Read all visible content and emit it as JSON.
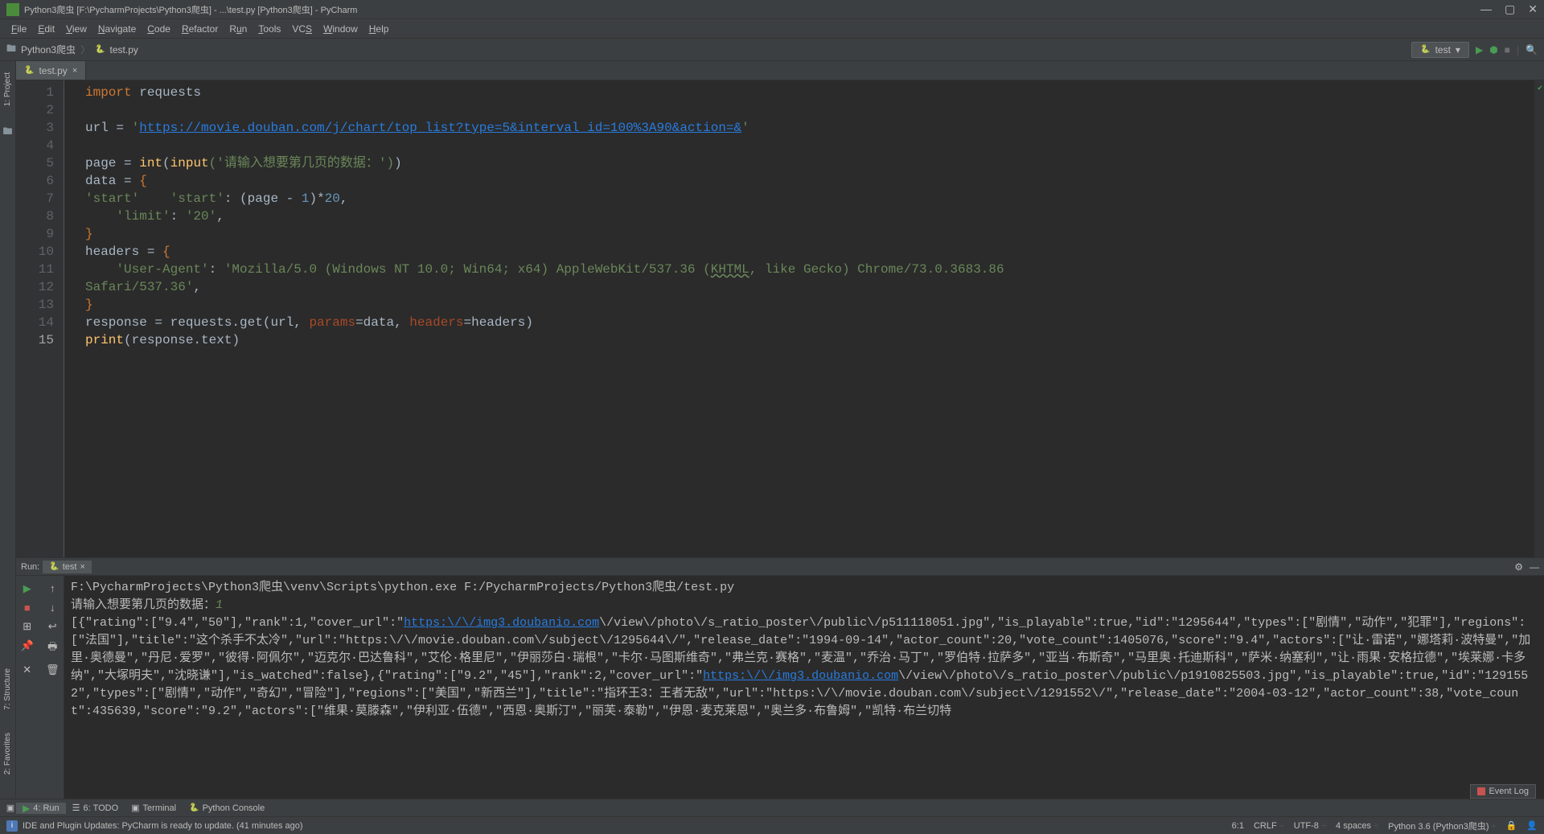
{
  "window": {
    "title": "Python3爬虫 [F:\\PycharmProjects\\Python3爬虫] - ...\\test.py [Python3爬虫] - PyCharm"
  },
  "menu": {
    "file": "File",
    "edit": "Edit",
    "view": "View",
    "navigate": "Navigate",
    "code": "Code",
    "refactor": "Refactor",
    "run": "Run",
    "tools": "Tools",
    "vcs": "VCS",
    "window": "Window",
    "help": "Help"
  },
  "breadcrumb": {
    "project": "Python3爬虫",
    "file": "test.py"
  },
  "run_config": {
    "name": "test"
  },
  "tab": {
    "file": "test.py"
  },
  "code": {
    "lines": [
      "1",
      "2",
      "3",
      "4",
      "5",
      "6",
      "7",
      "8",
      "9",
      "10",
      "11",
      "12",
      "13",
      "14",
      "15"
    ],
    "l1_import": "import",
    "l1_requests": " requests",
    "l3_url": "url = ",
    "l3_q1": "'",
    "l3_link": "https://movie.douban.com/j/chart/top_list?type=5&interval_id=100%3A90&action=&",
    "l3_q2": "'",
    "l5_page": "page = ",
    "l5_int": "int",
    "l5_open": "(",
    "l5_input": "input",
    "l5_str": "('请输入想要第几页的数据：')",
    "l5_close": ")",
    "l6_data": "data = {",
    "l7": "    'start': (page - 1)*20,",
    "l7_str": "'start'",
    "l7_rest": ": (page - ",
    "l7_num1": "1",
    "l7_rest2": ")*",
    "l7_num2": "20",
    "l7_rest3": ",",
    "l8_str": "    'limit'",
    "l8_mid": ": ",
    "l8_val": "'20'",
    "l8_end": ",",
    "l9": "}",
    "l10_headers": "headers = {",
    "l11_key": "    'User-Agent'",
    "l11_mid": ": ",
    "l11_val": "'Mozilla/5.0 (Windows NT 10.0; Win64; x64) AppleWebKit/537.36 (KHTML, like Gecko) Chrome/73.0.3683.86 Safari/537.36'",
    "l11_end": ",",
    "l12": "}",
    "l13_a": "response = requests.get(url, ",
    "l13_p1": "params",
    "l13_b": "=data, ",
    "l13_p2": "headers",
    "l13_c": "=headers)",
    "l14_a": "print",
    "l14_b": "(response.text)"
  },
  "run_panel": {
    "label": "Run:",
    "tab": "test",
    "cmd": "F:\\PycharmProjects\\Python3爬虫\\venv\\Scripts\\python.exe F:/PycharmProjects/Python3爬虫/test.py",
    "prompt": "请输入想要第几页的数据：",
    "input": "1",
    "out_pre1": "[{\"rating\":[\"9.4\",\"50\"],\"rank\":1,\"cover_url\":\"",
    "out_link1": "https:\\/\\/img3.doubanio.com",
    "out_post1": "\\/view\\/photo\\/s_ratio_poster\\/public\\/p511118051.jpg\",\"is_playable\":true,\"id\":\"1295644\",\"types\":[\"剧情\",\"动作\",\"犯罪\"],\"regions\":[\"法国\"],\"title\":\"这个杀手不太冷\",\"url\":\"https:\\/\\/movie.douban.com\\/subject\\/1295644\\/\",\"release_date\":\"1994-09-14\",\"actor_count\":20,\"vote_count\":1405076,\"score\":\"9.4\",\"actors\":[\"让·雷诺\",\"娜塔莉·波特曼\",\"加里·奥德曼\",\"丹尼·爱罗\",\"彼得·阿佩尔\",\"迈克尔·巴达鲁科\",\"艾伦·格里尼\",\"伊丽莎白·瑞根\",\"卡尔·马图斯维奇\",\"弗兰克·赛格\",\"麦温\",\"乔治·马丁\",\"罗伯特·拉萨多\",\"亚当·布斯奇\",\"马里奥·托迪斯科\",\"萨米·纳塞利\",\"让·雨果·安格拉德\",\"埃莱娜·卡多纳\",\"大塚明夫\",\"沈晓谦\"],\"is_watched\":false},{\"rating\":[\"9.2\",\"45\"],\"rank\":2,\"cover_url\":\"",
    "out_link2": "https:\\/\\/img3.doubanio.com",
    "out_post2": "\\/view\\/photo\\/s_ratio_poster\\/public\\/p1910825503.jpg\",\"is_playable\":true,\"id\":\"1291552\",\"types\":[\"剧情\",\"动作\",\"奇幻\",\"冒险\"],\"regions\":[\"美国\",\"新西兰\"],\"title\":\"指环王3：王者无敌\",\"url\":\"https:\\/\\/movie.douban.com\\/subject\\/1291552\\/\",\"release_date\":\"2004-03-12\",\"actor_count\":38,\"vote_count\":435639,\"score\":\"9.2\",\"actors\":[\"维果·莫滕森\",\"伊利亚·伍德\",\"西恩·奥斯汀\",\"丽芙·泰勒\",\"伊恩·麦克莱恩\",\"奥兰多·布鲁姆\",\"凯特·布兰切特"
  },
  "toolbar_bottom": {
    "run": "4: Run",
    "todo": "6: TODO",
    "terminal": "Terminal",
    "pyconsole": "Python Console",
    "event_log": "Event Log"
  },
  "status": {
    "msg": "IDE and Plugin Updates: PyCharm is ready to update. (41 minutes ago)",
    "pos": "6:1",
    "crlf": "CRLF",
    "enc": "UTF-8",
    "indent": "4 spaces",
    "interp": "Python 3.6 (Python3爬虫)"
  },
  "sidebar": {
    "project": "1: Project",
    "structure": "7: Structure",
    "favorites": "2: Favorites"
  }
}
